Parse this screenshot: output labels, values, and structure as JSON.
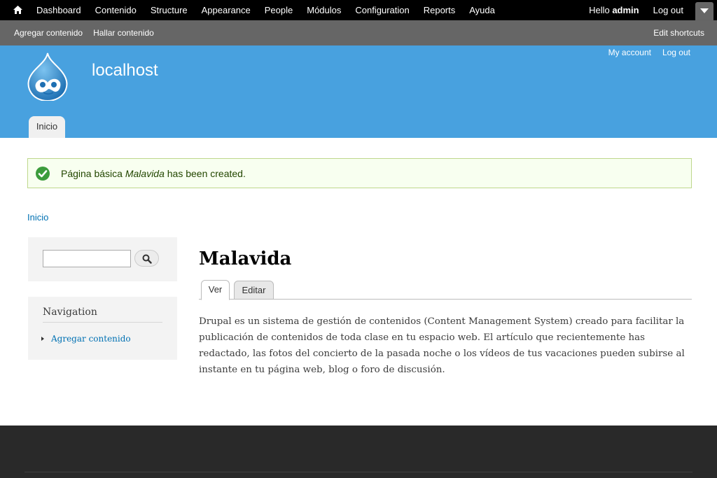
{
  "toolbar": {
    "menu": [
      "Dashboard",
      "Contenido",
      "Structure",
      "Appearance",
      "People",
      "Módulos",
      "Configuration",
      "Reports",
      "Ayuda"
    ],
    "hello_prefix": "Hello ",
    "user": "admin",
    "logout": "Log out"
  },
  "shortcuts": {
    "items": [
      "Agregar contenido",
      "Hallar contenido"
    ],
    "edit": "Edit shortcuts"
  },
  "header": {
    "site_name": "localhost",
    "secondary": [
      "My account",
      "Log out"
    ],
    "main_tab": "Inicio"
  },
  "message": {
    "prefix": "Página básica ",
    "title": "Malavida",
    "suffix": " has been created."
  },
  "breadcrumb": "Inicio",
  "search": {
    "value": ""
  },
  "navigation": {
    "title": "Navigation",
    "items": [
      "Agregar contenido"
    ]
  },
  "page": {
    "title": "Malavida",
    "tabs": [
      "Ver",
      "Editar"
    ],
    "body": "Drupal es un sistema de gestión de contenidos (Content Management System) creado para facilitar la publicación de contenidos de toda clase en tu espacio web. El artículo que recientemente has redactado, las fotos del concierto de la pasada noche o los vídeos de tus vacaciones pueden subirse al instante en tu página web, blog o foro de discusión."
  },
  "colors": {
    "header": "#48a1df",
    "toolbar": "#000000",
    "shortcuts": "#666666",
    "link": "#0071b3",
    "footer": "#292929"
  }
}
